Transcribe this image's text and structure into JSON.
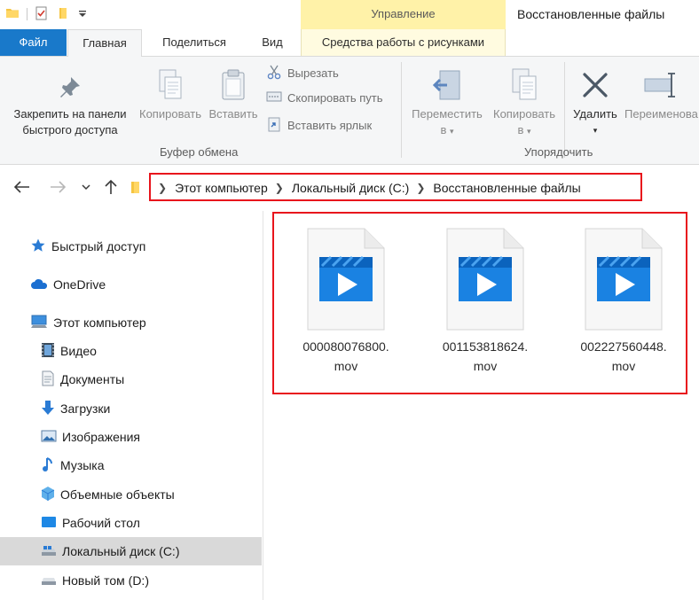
{
  "window": {
    "title": "Восстановленные файлы",
    "context_header": "Управление"
  },
  "tabs": {
    "file": "Файл",
    "home": "Главная",
    "share": "Поделиться",
    "view": "Вид",
    "picture_tools": "Средства работы с рисунками"
  },
  "ribbon": {
    "pin_line1": "Закрепить на панели",
    "pin_line2": "быстрого доступа",
    "copy": "Копировать",
    "paste": "Вставить",
    "cut": "Вырезать",
    "copy_path": "Скопировать путь",
    "paste_shortcut": "Вставить ярлык",
    "clipboard_group": "Буфер обмена",
    "move_to_line1": "Переместить",
    "move_to_line2": "в",
    "copy_to_line1": "Копировать",
    "copy_to_line2": "в",
    "delete": "Удалить",
    "rename": "Переименова",
    "organize_group": "Упорядочить"
  },
  "address": {
    "crumbs": [
      "Этот компьютер",
      "Локальный диск (C:)",
      "Восстановленные файлы"
    ]
  },
  "sidebar": {
    "items": [
      {
        "label": "Быстрый доступ",
        "icon": "star-icon"
      },
      {
        "label": "OneDrive",
        "icon": "cloud-icon"
      },
      {
        "label": "Этот компьютер",
        "icon": "computer-icon"
      },
      {
        "label": "Видео",
        "icon": "video-icon"
      },
      {
        "label": "Документы",
        "icon": "document-icon"
      },
      {
        "label": "Загрузки",
        "icon": "download-icon"
      },
      {
        "label": "Изображения",
        "icon": "image-icon"
      },
      {
        "label": "Музыка",
        "icon": "music-icon"
      },
      {
        "label": "Объемные объекты",
        "icon": "cube-icon"
      },
      {
        "label": "Рабочий стол",
        "icon": "desktop-icon"
      },
      {
        "label": "Локальный диск (C:)",
        "icon": "drive-icon",
        "selected": true
      },
      {
        "label": "Новый том (D:)",
        "icon": "drive-icon"
      }
    ]
  },
  "files": [
    {
      "line1": "000080076800.",
      "line2": "mov"
    },
    {
      "line1": "001153818624.",
      "line2": "mov"
    },
    {
      "line1": "002227560448.",
      "line2": "mov"
    }
  ],
  "colors": {
    "accent": "#1979ca",
    "highlight_border": "#e8141c",
    "context_tab": "#fff2a8"
  }
}
